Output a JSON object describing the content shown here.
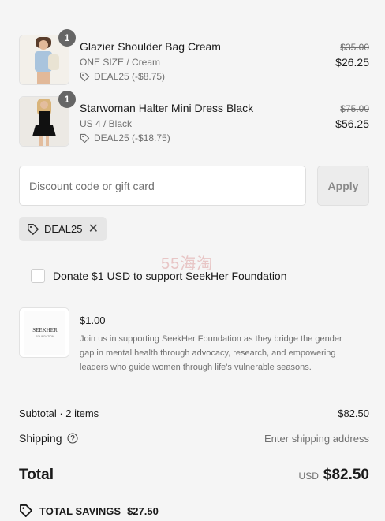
{
  "items": [
    {
      "name": "Glazier Shoulder Bag Cream",
      "variant": "ONE SIZE / Cream",
      "discount": "DEAL25 (-$8.75)",
      "original_price": "$35.00",
      "price": "$26.25",
      "quantity": "1"
    },
    {
      "name": "Starwoman Halter Mini Dress Black",
      "variant": "US 4 / Black",
      "discount": "DEAL25 (-$18.75)",
      "original_price": "$75.00",
      "price": "$56.25",
      "quantity": "1"
    }
  ],
  "discount_field": {
    "placeholder": "Discount code or gift card",
    "apply_label": "Apply"
  },
  "applied_code": "DEAL25",
  "watermark": "55海淘",
  "donation": {
    "checkbox_label": "Donate $1 USD to support SeekHer Foundation",
    "logo_text": "SEEKHER",
    "logo_sub": "FOUNDATION",
    "price": "$1.00",
    "description": "Join us in supporting SeekHer Foundation as they bridge the gender gap in mental health through advocacy, research, and empowering leaders who guide women through life's vulnerable seasons."
  },
  "summary": {
    "subtotal_label": "Subtotal · 2 items",
    "subtotal_value": "$82.50",
    "shipping_label": "Shipping",
    "shipping_value": "Enter shipping address",
    "total_label": "Total",
    "currency": "USD",
    "total_value": "$82.50",
    "savings_label": "TOTAL SAVINGS",
    "savings_value": "$27.50"
  }
}
